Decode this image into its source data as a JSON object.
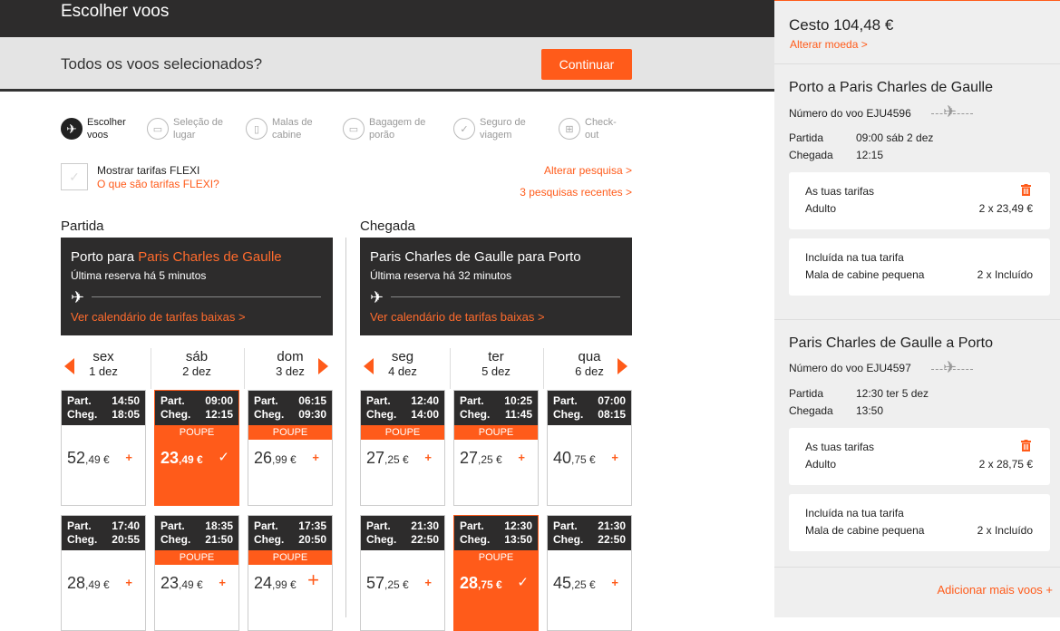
{
  "header": {
    "title": "Escolher voos"
  },
  "selection": {
    "question": "Todos os voos selecionados?",
    "continue_label": "Continuar"
  },
  "steps": [
    {
      "label1": "Escolher",
      "label2": "voos",
      "icon": "plane-icon",
      "active": true
    },
    {
      "label1": "Seleção de",
      "label2": "lugar",
      "icon": "seat-icon",
      "active": false
    },
    {
      "label1": "Malas de",
      "label2": "cabine",
      "icon": "cabin-bag-icon",
      "active": false
    },
    {
      "label1": "Bagagem de",
      "label2": "porão",
      "icon": "hold-bag-icon",
      "active": false
    },
    {
      "label1": "Seguro de",
      "label2": "viagem",
      "icon": "shield-icon",
      "active": false
    },
    {
      "label1": "Check-",
      "label2": "out",
      "icon": "basket-icon",
      "active": false
    }
  ],
  "flexi": {
    "label": "Mostrar tarifas FLEXI",
    "link": "O que são tarifas FLEXI?"
  },
  "links": {
    "change_search": "Alterar pesquisa >",
    "recent_searches": "3 pesquisas recentes >"
  },
  "outbound": {
    "heading": "Partida",
    "route_from": "Porto para ",
    "route_to": "Paris Charles de Gaulle",
    "last_booking": "Última reserva há 5 minutos",
    "calendar_link": "Ver calendário de tarifas baixas >",
    "days": [
      {
        "dow": "sex",
        "date": "1 dez"
      },
      {
        "dow": "sáb",
        "date": "2 dez"
      },
      {
        "dow": "dom",
        "date": "3 dez"
      }
    ],
    "flights": [
      [
        {
          "dep": "14:50",
          "arr": "18:05",
          "int": "52",
          "dec": ",49 €",
          "badge": "",
          "selected": false
        },
        {
          "dep": "17:40",
          "arr": "20:55",
          "int": "28",
          "dec": ",49 €",
          "badge": "",
          "selected": false
        }
      ],
      [
        {
          "dep": "09:00",
          "arr": "12:15",
          "int": "23",
          "dec": ",49 €",
          "badge": "POUPE",
          "selected": true
        },
        {
          "dep": "18:35",
          "arr": "21:50",
          "int": "23",
          "dec": ",49 €",
          "badge": "POUPE",
          "selected": false
        }
      ],
      [
        {
          "dep": "06:15",
          "arr": "09:30",
          "int": "26",
          "dec": ",99 €",
          "badge": "POUPE",
          "selected": false
        },
        {
          "dep": "17:35",
          "arr": "20:50",
          "int": "24",
          "dec": ",99 €",
          "badge": "POUPE",
          "selected": false,
          "big_plus": true
        }
      ]
    ]
  },
  "inbound": {
    "heading": "Chegada",
    "route": "Paris Charles de Gaulle para Porto",
    "last_booking": "Última reserva há 32 minutos",
    "calendar_link": "Ver calendário de tarifas baixas >",
    "days": [
      {
        "dow": "seg",
        "date": "4 dez"
      },
      {
        "dow": "ter",
        "date": "5 dez"
      },
      {
        "dow": "qua",
        "date": "6 dez"
      }
    ],
    "flights": [
      [
        {
          "dep": "12:40",
          "arr": "14:00",
          "int": "27",
          "dec": ",25 €",
          "badge": "POUPE",
          "selected": false
        },
        {
          "dep": "21:30",
          "arr": "22:50",
          "int": "57",
          "dec": ",25 €",
          "badge": "",
          "selected": false
        }
      ],
      [
        {
          "dep": "10:25",
          "arr": "11:45",
          "int": "27",
          "dec": ",25 €",
          "badge": "POUPE",
          "selected": false
        },
        {
          "dep": "12:30",
          "arr": "13:50",
          "int": "28",
          "dec": ",75 €",
          "badge": "POUPE",
          "selected": true
        }
      ],
      [
        {
          "dep": "07:00",
          "arr": "08:15",
          "int": "40",
          "dec": ",75 €",
          "badge": "",
          "selected": false
        },
        {
          "dep": "21:30",
          "arr": "22:50",
          "int": "45",
          "dec": ",25 €",
          "badge": "",
          "selected": false
        }
      ]
    ]
  },
  "card_labels": {
    "dep": "Part.",
    "arr": "Cheg."
  },
  "basket": {
    "title": "Cesto 104,48 €",
    "change_currency": "Alterar moeda >",
    "legs": [
      {
        "title": "Porto a Paris Charles de Gaulle",
        "flight_no": "Número do voo EJU4596",
        "dep_label": "Partida",
        "dep_value": "09:00 sáb 2 dez",
        "arr_label": "Chegada",
        "arr_value": "12:15",
        "fares_title": "As tuas tarifas",
        "fare_type": "Adulto",
        "fare_value": "2 x 23,49 €",
        "incl_title": "Incluída na tua tarifa",
        "incl_item": "Mala de cabine pequena",
        "incl_value": "2 x Incluído"
      },
      {
        "title": "Paris Charles de Gaulle a Porto",
        "flight_no": "Número do voo EJU4597",
        "dep_label": "Partida",
        "dep_value": "12:30 ter 5 dez",
        "arr_label": "Chegada",
        "arr_value": "13:50",
        "fares_title": "As tuas tarifas",
        "fare_type": "Adulto",
        "fare_value": "2 x 28,75 €",
        "incl_title": "Incluída na tua tarifa",
        "incl_item": "Mala de cabine pequena",
        "incl_value": "2 x Incluído"
      }
    ],
    "add_more": "Adicionar mais voos +"
  },
  "colors": {
    "accent": "#ff5b1a",
    "dark": "#2d2c2c",
    "panel": "#efefef"
  }
}
